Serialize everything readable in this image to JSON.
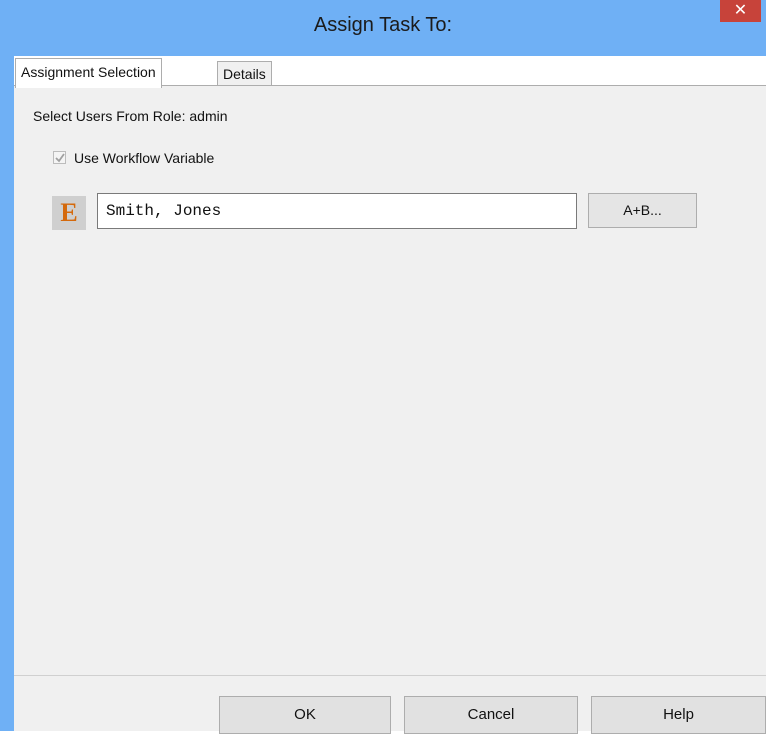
{
  "window": {
    "title": "Assign Task To:",
    "close_glyph": "✕"
  },
  "tabs": [
    {
      "label": "Assignment Selection",
      "active": true
    },
    {
      "label": "Details",
      "active": false
    }
  ],
  "assignment": {
    "role_label": "Select Users From Role: admin",
    "use_workflow_variable": {
      "label": "Use Workflow Variable",
      "checked": true,
      "enabled": false
    },
    "expression_icon_letter": "E",
    "variable_value": "Smith, Jones",
    "expression_button_label": "A+B..."
  },
  "buttons": {
    "ok": "OK",
    "cancel": "Cancel",
    "help": "Help"
  },
  "colors": {
    "titlebar": "#6fb0f5",
    "close_button": "#c7433a",
    "expression_icon": "#d4690c"
  }
}
